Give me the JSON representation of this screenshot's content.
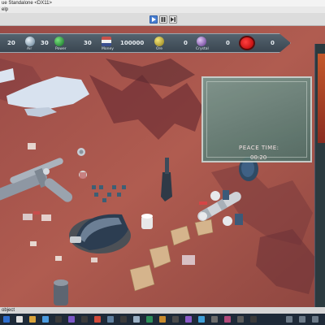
{
  "window": {
    "title": "ue Standalone <DX11>",
    "menu": "elp"
  },
  "status_bar": {
    "text": "object"
  },
  "hud": {
    "resources": [
      {
        "value": "20",
        "label": "",
        "icon": "unknown-resource-icon",
        "color": "#6f8796"
      },
      {
        "value": "30",
        "label": "Air",
        "icon": "air-globe-icon",
        "color": "#a9c4d6"
      },
      {
        "value": "30",
        "label": "Power",
        "icon": "power-globe-icon",
        "color": "#1fa53a"
      },
      {
        "value": "100000",
        "label": "Money",
        "icon": "money-flag-icon",
        "color": "#c8524b"
      },
      {
        "value": "0",
        "label": "Ore",
        "icon": "ore-globe-icon",
        "color": "#d4c037"
      },
      {
        "value": "0",
        "label": "Crystal",
        "icon": "crystal-globe-icon",
        "color": "#9a6cc9"
      },
      {
        "value": "0",
        "label": "",
        "icon": "alert-icon",
        "color": "#e11d1d"
      }
    ]
  },
  "peace": {
    "label": "PEACE TIME:",
    "value": "00:20"
  },
  "colors": {
    "hud_bg": "#46535e",
    "terrain": "#a5564b",
    "minimap": "#6f8c84",
    "taskbar": "#1e2a38"
  }
}
